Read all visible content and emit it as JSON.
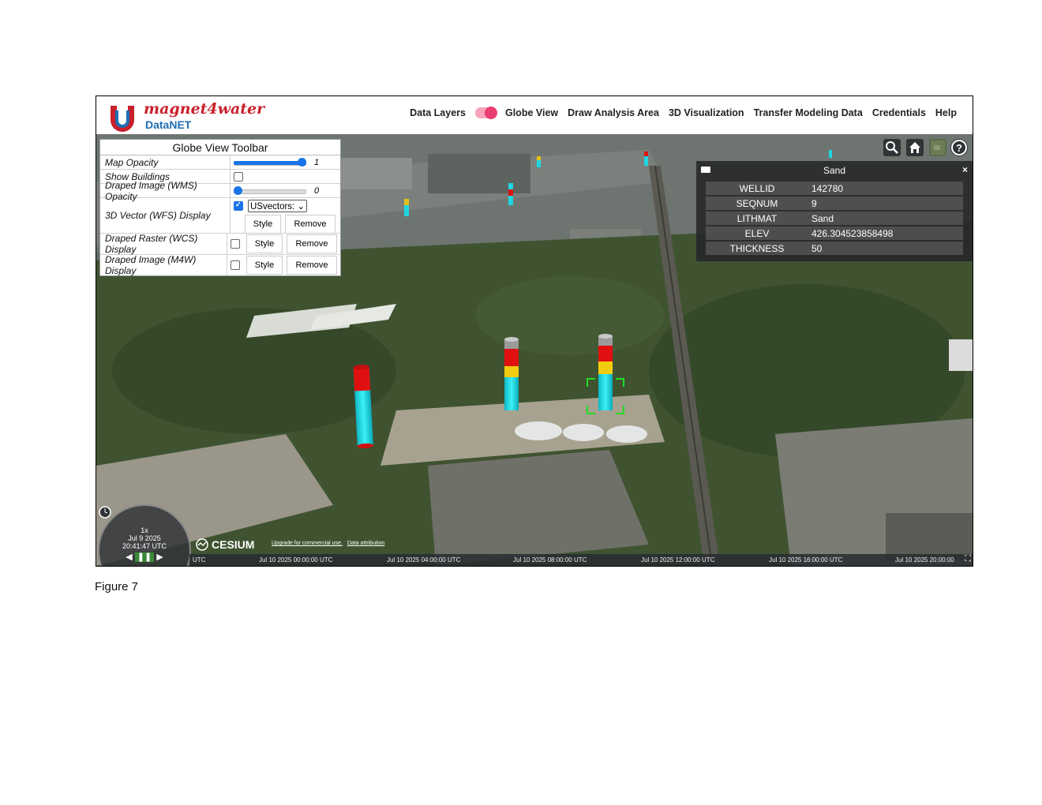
{
  "header": {
    "logo_title": "magnet4water",
    "logo_subtitle": "DataNET",
    "nav": [
      "Data Layers",
      "Globe View",
      "Draw Analysis Area",
      "3D Visualization",
      "Transfer Modeling Data",
      "Credentials",
      "Help"
    ]
  },
  "toolbar": {
    "title": "Globe View Toolbar",
    "map_opacity_label": "Map Opacity",
    "map_opacity_value": "1",
    "map_opacity": 1,
    "show_buildings_label": "Show Buildings",
    "show_buildings": false,
    "wms_label": "Draped Image (WMS) Opacity",
    "wms_value": "0",
    "wms_opacity": 0,
    "wfs_label": "3D Vector (WFS) Display",
    "wfs_checked": true,
    "wfs_select": "USvectors:",
    "wcs_label": "Draped Raster (WCS) Display",
    "wcs_checked": false,
    "m4w_label": "Draped Image (M4W) Display",
    "m4w_checked": false,
    "style_label": "Style",
    "remove_label": "Remove"
  },
  "info_box": {
    "title": "Sand",
    "close": "×",
    "rows": [
      {
        "key": "WELLID",
        "value": "142780"
      },
      {
        "key": "SEQNUM",
        "value": "9"
      },
      {
        "key": "LITHMAT",
        "value": "Sand"
      },
      {
        "key": "ELEV",
        "value": "426.304523858498"
      },
      {
        "key": "THICKNESS",
        "value": "50"
      }
    ]
  },
  "clock": {
    "speed": "1x",
    "date": "Jul 9 2025",
    "time": "20:41:47 UTC"
  },
  "timeline": {
    "labels": [
      "UTC",
      "Jul 10 2025 00:00:00 UTC",
      "Jul 10 2025 04:00:00 UTC",
      "Jul 10 2025 08:00:00 UTC",
      "Jul 10 2025 12:00:00 UTC",
      "Jul 10 2025 16:00:00 UTC",
      "Jul 10 2025 20:00:00"
    ]
  },
  "cesium": {
    "logo": "CESIUM",
    "upgrade": "Upgrade for commercial use.",
    "attribution": "Data attribution"
  },
  "caption": "Figure 7",
  "colors": {
    "accent": "#1a73e8",
    "brand_red": "#c8202c",
    "brand_blue": "#1f6fb4",
    "toggle": "#ea3d72"
  }
}
